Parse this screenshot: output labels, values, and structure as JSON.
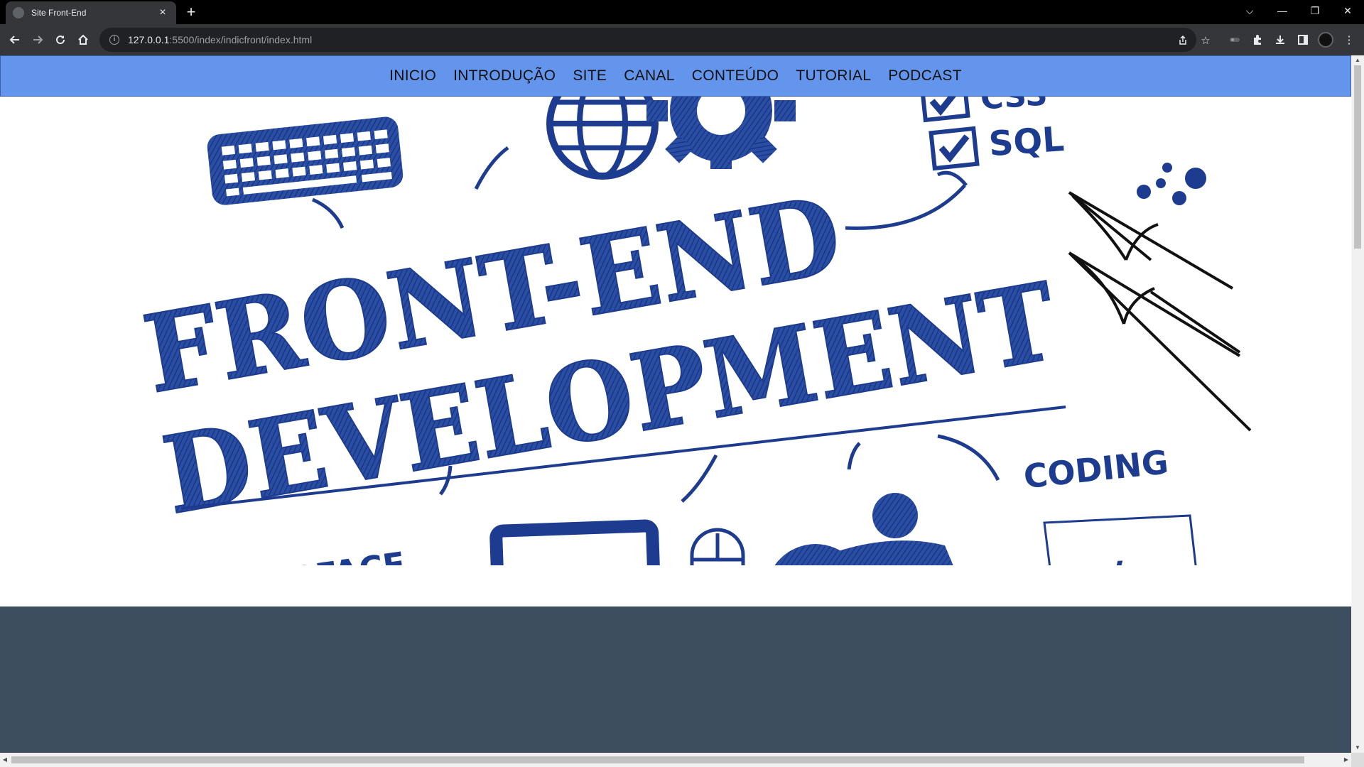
{
  "browser": {
    "tab_title": "Site Front-End",
    "tab_close": "×",
    "new_tab": "+",
    "url_host": "127.0.0.1",
    "url_rest": ":5500/index/indicfront/index.html",
    "controls": {
      "dropdown": "⌵",
      "minimize": "—",
      "restore": "❐",
      "close": "✕"
    }
  },
  "nav": {
    "items": [
      {
        "label": "INICIO"
      },
      {
        "label": "INTRODUÇÃO"
      },
      {
        "label": "SITE"
      },
      {
        "label": "CANAL"
      },
      {
        "label": "CONTEÚDO"
      },
      {
        "label": "TUTORIAL"
      },
      {
        "label": "PODCAST"
      }
    ]
  },
  "hero": {
    "line1": "FRONT-END",
    "line2": "DEVELOPMENT",
    "css_label": "CSS",
    "sql_label": "SQL",
    "coding_label": "CODING",
    "interface_label": "iNTERFACE",
    "code_tag": "</>"
  },
  "colors": {
    "nav_bg": "#6495ed",
    "footer_bg": "#3d4e5e",
    "ink_blue": "#1d3c8f"
  }
}
